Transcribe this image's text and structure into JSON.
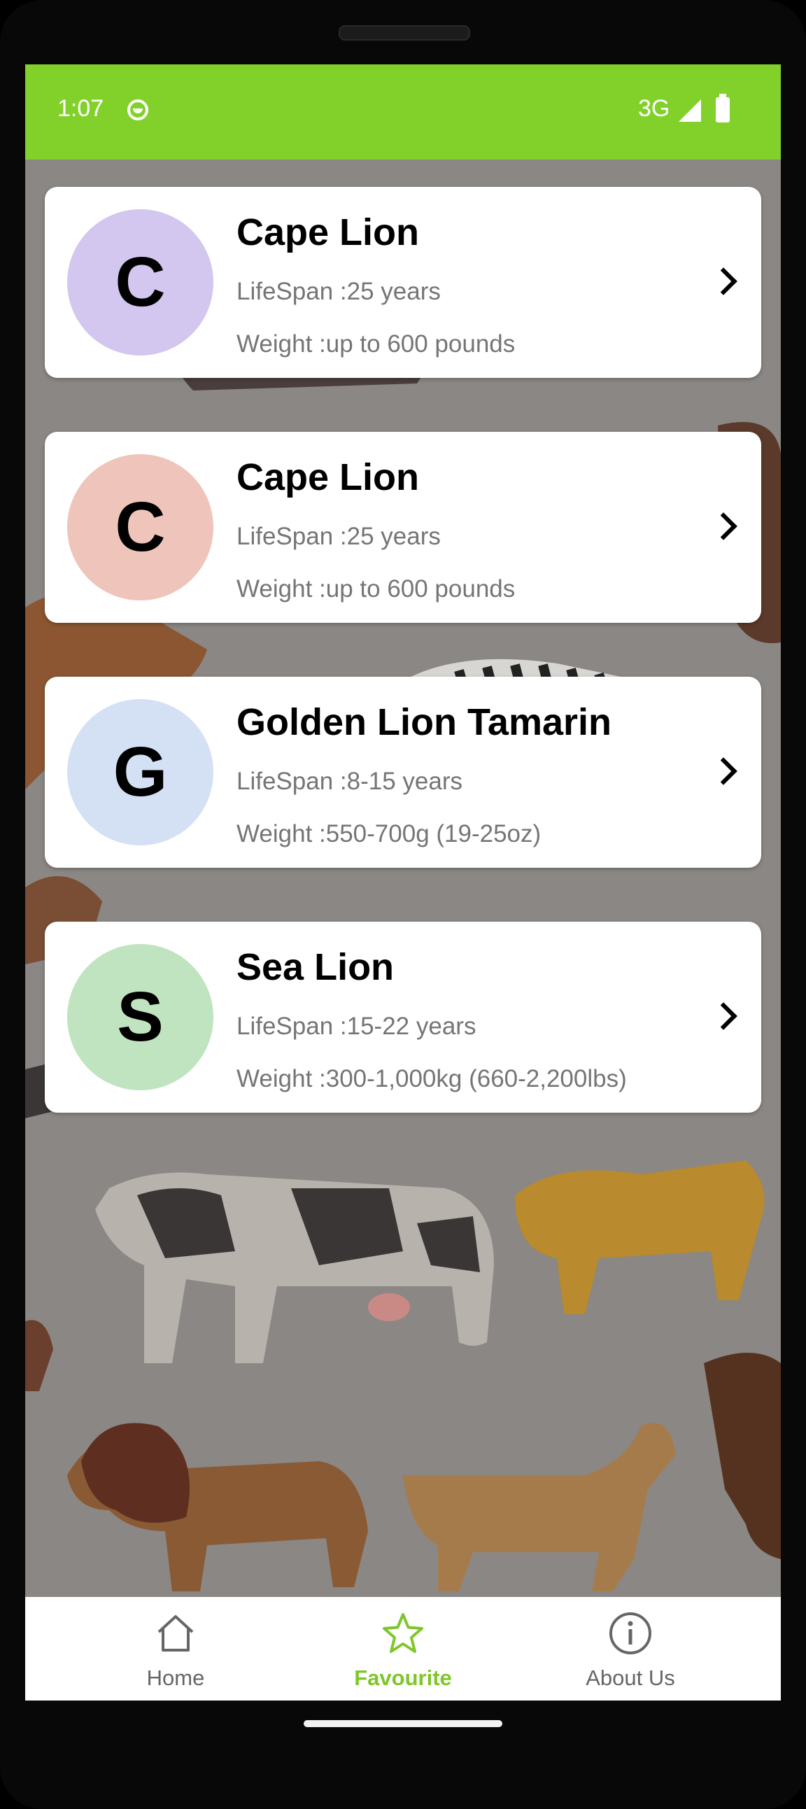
{
  "status_bar": {
    "time": "1:07",
    "network": "3G",
    "color": "#82d12b"
  },
  "animals": [
    {
      "initial": "C",
      "name": "Cape Lion",
      "lifespan": "LifeSpan :25 years",
      "weight": "Weight :up to 600 pounds",
      "avatar_color": "#d3c6ef"
    },
    {
      "initial": "C",
      "name": "Cape Lion",
      "lifespan": "LifeSpan :25 years",
      "weight": "Weight :up to 600 pounds",
      "avatar_color": "#efc4ba"
    },
    {
      "initial": "G",
      "name": "Golden Lion Tamarin",
      "lifespan": "LifeSpan :8-15 years",
      "weight": "Weight :550-700g (19-25oz)",
      "avatar_color": "#d4e1f5"
    },
    {
      "initial": "S",
      "name": "Sea Lion",
      "lifespan": "LifeSpan :15-22 years",
      "weight": "Weight :300-1,000kg (660-2,200lbs)",
      "avatar_color": "#bfe4bf"
    }
  ],
  "nav": {
    "items": [
      {
        "label": "Home",
        "icon": "home-icon",
        "active": false
      },
      {
        "label": "Favourite",
        "icon": "star-icon",
        "active": true
      },
      {
        "label": "About Us",
        "icon": "info-icon",
        "active": false
      }
    ],
    "active_color": "#7fc62b"
  }
}
